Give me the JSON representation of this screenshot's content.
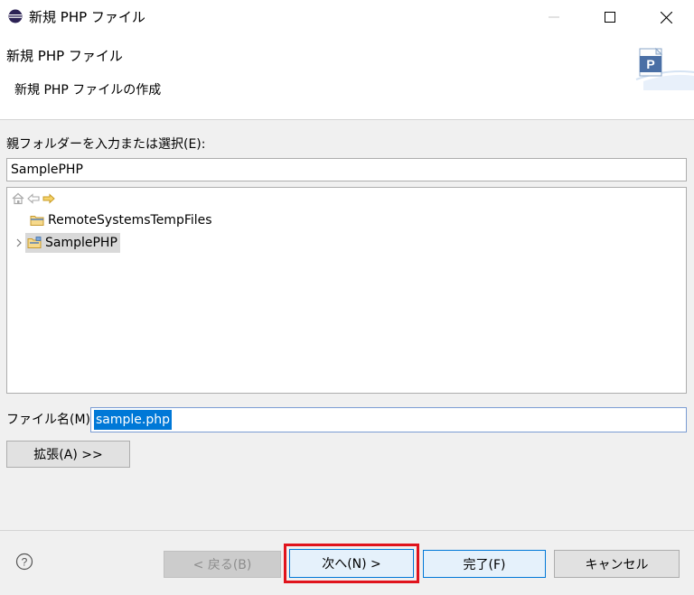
{
  "window": {
    "title": "新規 PHP ファイル",
    "controls": [
      "minimize",
      "maximize",
      "close"
    ]
  },
  "header": {
    "title": "新規 PHP ファイル",
    "description": "新規 PHP ファイルの作成"
  },
  "parent_folder": {
    "label": "親フォルダーを入力または選択(E):",
    "value": "SamplePHP"
  },
  "tree": {
    "toolbar_icons": [
      "home-icon",
      "back-arrow-icon",
      "forward-arrow-icon"
    ],
    "items": [
      {
        "label": "RemoteSystemsTempFiles",
        "expandable": false,
        "selected": false
      },
      {
        "label": "SamplePHP",
        "expandable": true,
        "selected": true
      }
    ]
  },
  "file_name": {
    "label": "ファイル名(M):",
    "value": "sample.php"
  },
  "advanced_button": "拡張(A) >>",
  "footer": {
    "back": "< 戻る(B)",
    "next": "次へ(N) >",
    "finish": "完了(F)",
    "cancel": "キャンセル"
  },
  "colors": {
    "highlight_border": "#e0131c",
    "selection": "#0078d7",
    "default_button_border": "#0078d7"
  }
}
